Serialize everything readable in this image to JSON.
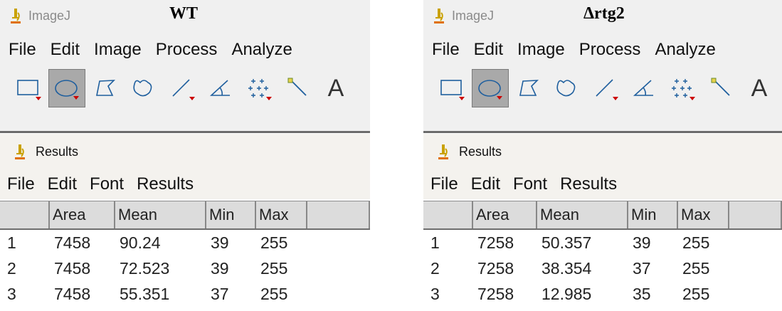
{
  "panels": [
    {
      "id": "wt",
      "caption": "WT",
      "imagej": {
        "app_name": "ImageJ",
        "menu": [
          "File",
          "Edit",
          "Image",
          "Process",
          "Analyze"
        ],
        "tools": [
          {
            "icon": "rectangle-tool-icon",
            "selected": false,
            "has_menu": true
          },
          {
            "icon": "oval-tool-icon",
            "selected": true,
            "has_menu": true
          },
          {
            "icon": "polygon-tool-icon",
            "selected": false,
            "has_menu": false
          },
          {
            "icon": "freehand-tool-icon",
            "selected": false,
            "has_menu": false
          },
          {
            "icon": "line-tool-icon",
            "selected": false,
            "has_menu": true
          },
          {
            "icon": "angle-tool-icon",
            "selected": false,
            "has_menu": false
          },
          {
            "icon": "point-tool-icon",
            "selected": false,
            "has_menu": true
          },
          {
            "icon": "wand-tool-icon",
            "selected": false,
            "has_menu": false
          },
          {
            "icon": "text-tool-icon",
            "selected": false,
            "has_menu": false,
            "glyph": "A"
          }
        ]
      },
      "results": {
        "title": "Results",
        "menu": [
          "File",
          "Edit",
          "Font",
          "Results"
        ],
        "columns": [
          "",
          "Area",
          "Mean",
          "Min",
          "Max"
        ],
        "rows": [
          [
            "1",
            "7458",
            "90.24",
            "39",
            "255"
          ],
          [
            "2",
            "7458",
            "72.523",
            "39",
            "255"
          ],
          [
            "3",
            "7458",
            "55.351",
            "37",
            "255"
          ]
        ]
      }
    },
    {
      "id": "artg2",
      "caption": "Δrtg2",
      "imagej": {
        "app_name": "ImageJ",
        "menu": [
          "File",
          "Edit",
          "Image",
          "Process",
          "Analyze"
        ],
        "tools": [
          {
            "icon": "rectangle-tool-icon",
            "selected": false,
            "has_menu": true
          },
          {
            "icon": "oval-tool-icon",
            "selected": true,
            "has_menu": true
          },
          {
            "icon": "polygon-tool-icon",
            "selected": false,
            "has_menu": false
          },
          {
            "icon": "freehand-tool-icon",
            "selected": false,
            "has_menu": false
          },
          {
            "icon": "line-tool-icon",
            "selected": false,
            "has_menu": true
          },
          {
            "icon": "angle-tool-icon",
            "selected": false,
            "has_menu": false
          },
          {
            "icon": "point-tool-icon",
            "selected": false,
            "has_menu": true
          },
          {
            "icon": "wand-tool-icon",
            "selected": false,
            "has_menu": false
          },
          {
            "icon": "text-tool-icon",
            "selected": false,
            "has_menu": false,
            "glyph": "A"
          }
        ]
      },
      "results": {
        "title": "Results",
        "menu": [
          "File",
          "Edit",
          "Font",
          "Results"
        ],
        "columns": [
          "",
          "Area",
          "Mean",
          "Min",
          "Max"
        ],
        "rows": [
          [
            "1",
            "7258",
            "50.357",
            "39",
            "255"
          ],
          [
            "2",
            "7258",
            "38.354",
            "37",
            "255"
          ],
          [
            "3",
            "7258",
            "12.985",
            "35",
            "255"
          ]
        ]
      }
    }
  ]
}
